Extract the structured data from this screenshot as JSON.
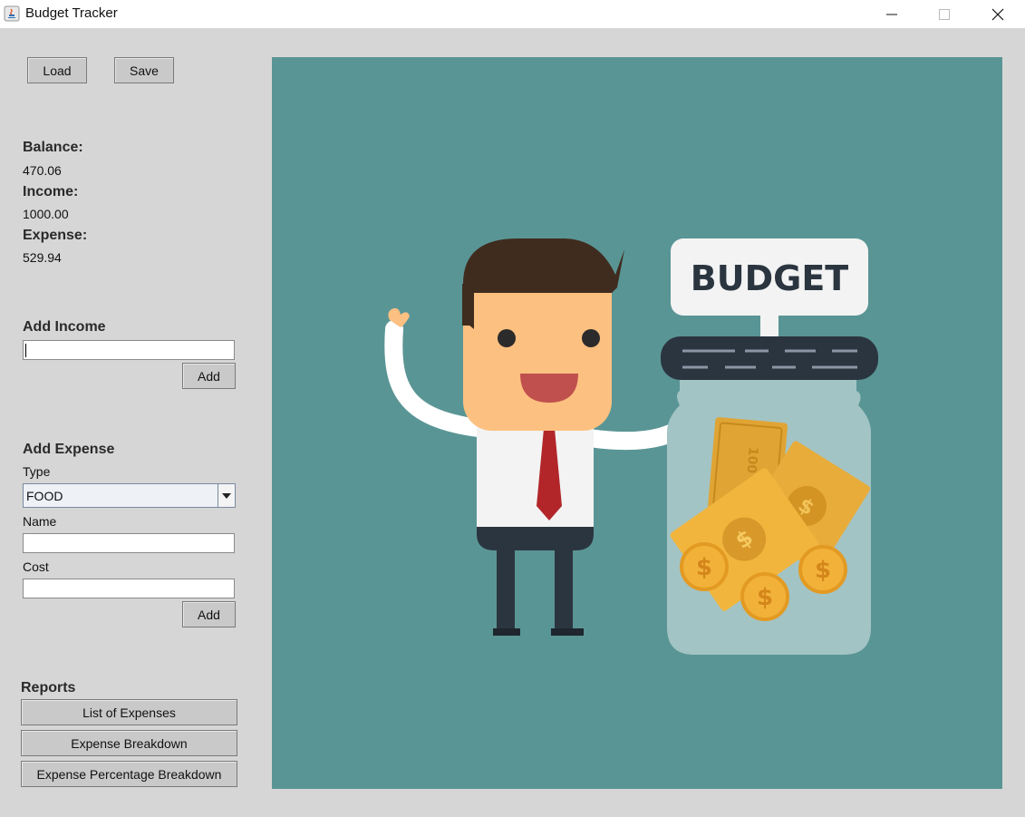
{
  "window": {
    "title": "Budget Tracker"
  },
  "toolbar": {
    "load_label": "Load",
    "save_label": "Save"
  },
  "summary": {
    "balance_label": "Balance:",
    "balance_value": "470.06",
    "income_label": "Income:",
    "income_value": "1000.00",
    "expense_label": "Expense:",
    "expense_value": "529.94"
  },
  "add_income": {
    "heading": "Add Income",
    "amount_value": "",
    "add_label": "Add"
  },
  "add_expense": {
    "heading": "Add Expense",
    "type_label": "Type",
    "type_selected": "FOOD",
    "name_label": "Name",
    "name_value": "",
    "cost_label": "Cost",
    "cost_value": "",
    "add_label": "Add"
  },
  "reports": {
    "heading": "Reports",
    "buttons": [
      "List of Expenses",
      "Expense Breakdown",
      "Expense Percentage Breakdown"
    ]
  },
  "illustration": {
    "sign_text": "BUDGET",
    "bill_text": "100",
    "background_color": "#5a9595",
    "icon": "businessman-with-money-jar-icon"
  },
  "colors": {
    "window_bg": "#d6d6d6",
    "button_bg": "#c9c9c9"
  }
}
